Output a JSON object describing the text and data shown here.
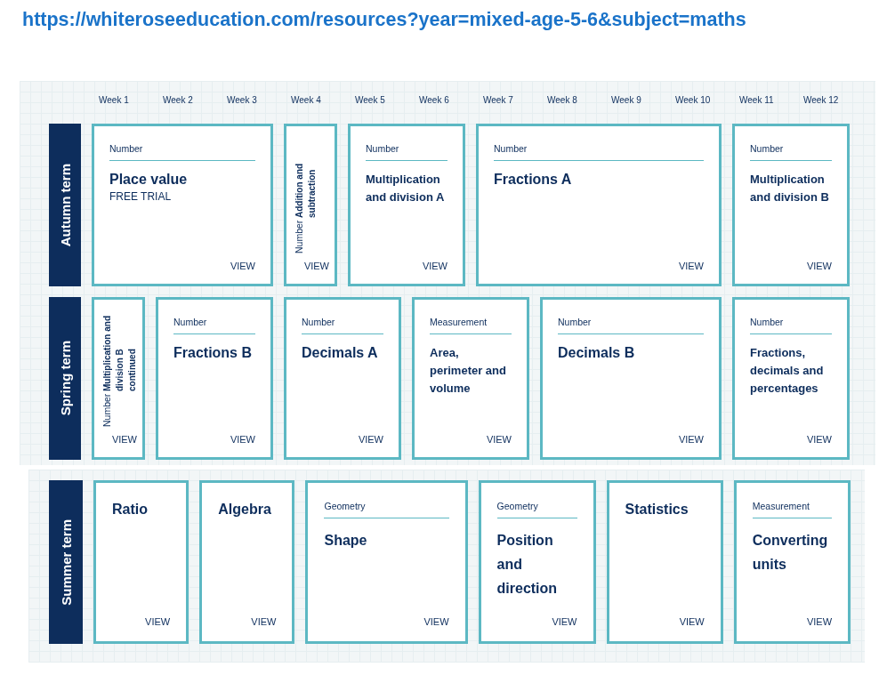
{
  "url": "https://whiteroseeducation.com/resources?year=mixed-age-5-6&subject=maths",
  "weeks": [
    "Week 1",
    "Week 2",
    "Week 3",
    "Week 4",
    "Week 5",
    "Week 6",
    "Week 7",
    "Week 8",
    "Week 9",
    "Week 10",
    "Week 11",
    "Week 12"
  ],
  "terms": [
    {
      "name": "Autumn term",
      "cards": [
        {
          "kind": "standard",
          "subject": "Number",
          "title": "Place value",
          "note": "FREE TRIAL",
          "action": "VIEW"
        },
        {
          "kind": "vertical",
          "subject": "Number",
          "title": "Addition and subtraction",
          "action": "VIEW"
        },
        {
          "kind": "standard",
          "subject": "Number",
          "title": "Multiplication and division A",
          "action": "VIEW"
        },
        {
          "kind": "standard",
          "subject": "Number",
          "title": "Fractions A",
          "action": "VIEW"
        },
        {
          "kind": "standard",
          "subject": "Number",
          "title": "Multiplication and division B",
          "action": "VIEW"
        }
      ]
    },
    {
      "name": "Spring term",
      "cards": [
        {
          "kind": "vertical",
          "subject": "Number",
          "title": "Multiplication and division B continued",
          "action": "VIEW"
        },
        {
          "kind": "standard",
          "subject": "Number",
          "title": "Fractions B",
          "action": "VIEW"
        },
        {
          "kind": "standard",
          "subject": "Number",
          "title": "Decimals A",
          "action": "VIEW"
        },
        {
          "kind": "standard",
          "subject": "Measurement",
          "title": "Area, perimeter and volume",
          "action": "VIEW"
        },
        {
          "kind": "standard",
          "subject": "Number",
          "title": "Decimals B",
          "action": "VIEW"
        },
        {
          "kind": "standard",
          "subject": "Number",
          "title": "Fractions, decimals and percentages",
          "action": "VIEW"
        }
      ]
    },
    {
      "name": "Summer term",
      "cards": [
        {
          "kind": "standard",
          "title": "Ratio",
          "action": "VIEW"
        },
        {
          "kind": "standard",
          "title": "Algebra",
          "action": "VIEW"
        },
        {
          "kind": "standard",
          "subject": "Geometry",
          "title": "Shape",
          "action": "VIEW"
        },
        {
          "kind": "standard",
          "subject": "Geometry",
          "title": "Position and direction",
          "action": "VIEW"
        },
        {
          "kind": "standard",
          "title": "Statistics",
          "action": "VIEW"
        },
        {
          "kind": "standard",
          "subject": "Measurement",
          "title": "Converting units",
          "action": "VIEW"
        }
      ]
    }
  ]
}
